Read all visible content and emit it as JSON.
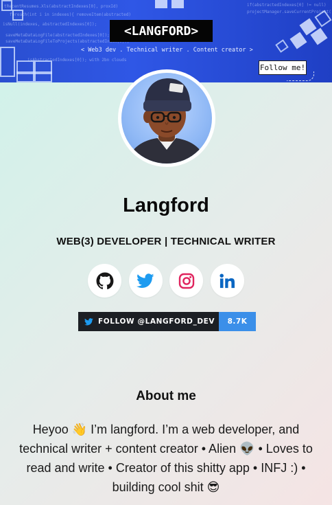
{
  "banner": {
    "title": "<LANGFORD>",
    "tagline": "<  Web3 dev . Technical writer . Content creator  >",
    "follow_label": "Follow me!"
  },
  "profile": {
    "name": "Langford",
    "role": "WEB(3) DEVELOPER | TECHNICAL WRITER"
  },
  "socials": [
    {
      "icon": "github-icon"
    },
    {
      "icon": "twitter-icon"
    },
    {
      "icon": "instagram-icon"
    },
    {
      "icon": "linkedin-icon"
    }
  ],
  "follow_button": {
    "label": "FOLLOW @LANGFORD_DEV",
    "count": "8.7K"
  },
  "about": {
    "title": "About me",
    "text": "Heyoo 👋 I’m langford. I’m a web developer, and technical writer + content creator • Alien 👽 • Loves to read and write • Creator of this shitty app • INFJ :) • building cool shit 😎"
  },
  "colors": {
    "banner": "#2f57e6",
    "twitter": "#1d9bf0",
    "instagram": "#e0245e",
    "linkedin": "#0a66c2",
    "follow_dark": "#1c1f24",
    "follow_blue": "#3b8fe9"
  }
}
